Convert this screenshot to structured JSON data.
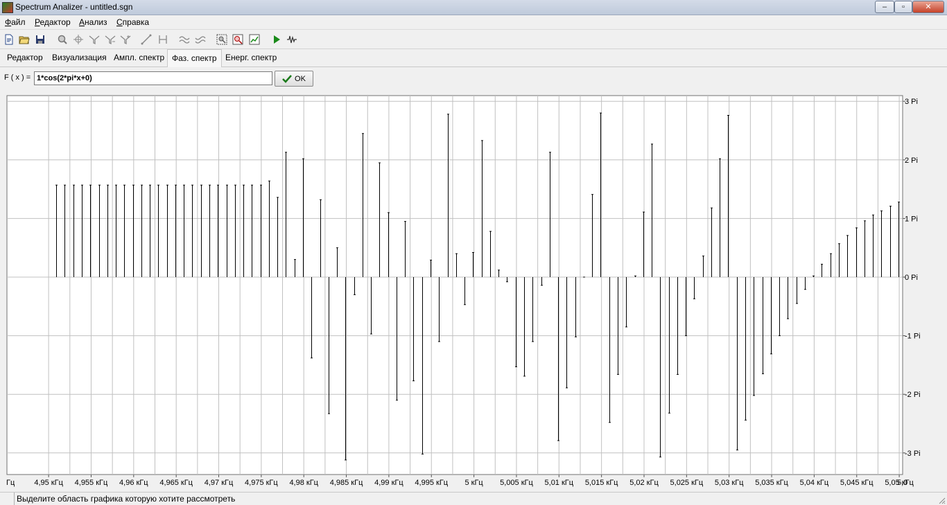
{
  "window": {
    "title": "Spectrum Analizer - untitled.sgn",
    "minimize": "–",
    "maximize": "▫",
    "close": "✕"
  },
  "menu": [
    {
      "underline": "Ф",
      "rest": "айл"
    },
    {
      "underline": "Р",
      "rest": "едактор"
    },
    {
      "underline": "А",
      "rest": "нализ"
    },
    {
      "underline": "С",
      "rest": "правка"
    }
  ],
  "toolbar": {
    "icons": [
      "new-file-icon",
      "open-folder-icon",
      "save-icon",
      "zoom-icon",
      "crosshair-icon",
      "filter-icon",
      "filter-2-icon",
      "filter-3-icon",
      "line-icon",
      "bracket-icon",
      "wave-filter-icon",
      "wave-filter-2-icon",
      "select-zoom-icon",
      "zoom-reset-icon",
      "chart-icon",
      "play-icon",
      "signal-icon"
    ]
  },
  "tabs": [
    "Редактор",
    "Визуализация",
    "Ампл. спектр",
    "Фаз. спектр",
    "Енерг. спектр"
  ],
  "active_tab": 3,
  "formula": {
    "label": "F ( x ) =",
    "value": "1*cos(2*pi*x+0)",
    "ok": "OK"
  },
  "status": {
    "text": "Выделите область графика которую хотите рассмотреть"
  },
  "colors": {
    "plot_bg": "#ffffff",
    "grid": "#c0c0c0",
    "stem": "#000000",
    "ok_check": "#1a7a1a",
    "play": "#1a8a1a"
  },
  "chart_data": {
    "type": "bar",
    "title": "",
    "xlabel": "",
    "ylabel": "",
    "y_unit": "Pi",
    "ylim": [
      -3,
      3
    ],
    "y_ticks": [
      "3 Pi",
      "2 Pi",
      "1 Pi",
      "0 Pi",
      "-1 Pi",
      "-2 Pi",
      "-3 Pi"
    ],
    "y_tick_values": [
      3,
      2,
      1,
      0,
      -1,
      -2,
      -3
    ],
    "x_unit": "kHz",
    "xlim": [
      4.9451,
      5.0504
    ],
    "x_ticks": [
      "Гц",
      "4,95 кГц",
      "4,955 кГц",
      "4,96 кГц",
      "4,965 кГц",
      "4,97 кГц",
      "4,975 кГц",
      "4,98 кГц",
      "4,985 кГц",
      "4,99 кГц",
      "4,995 кГц",
      "5 кГц",
      "5,005 кГц",
      "5,01 кГц",
      "5,015 кГц",
      "5,02 кГц",
      "5,025 кГц",
      "5,03 кГц",
      "5,035 кГц",
      "5,04 кГц",
      "5,045 кГц",
      "5,05 кГц",
      "5,0"
    ],
    "x_tick_values": [
      4.9451,
      4.95,
      4.955,
      4.96,
      4.965,
      4.97,
      4.975,
      4.98,
      4.985,
      4.99,
      4.995,
      5.0,
      5.005,
      5.01,
      5.015,
      5.02,
      5.025,
      5.03,
      5.035,
      5.04,
      5.045,
      5.05,
      5.0504
    ],
    "grid": true,
    "x": [
      4.9509,
      4.9519,
      4.9529,
      4.9539,
      4.9549,
      4.9559,
      4.9569,
      4.9579,
      4.9589,
      4.9599,
      4.9609,
      4.9619,
      4.9629,
      4.9639,
      4.9649,
      4.9659,
      4.9669,
      4.9679,
      4.9689,
      4.9699,
      4.9709,
      4.9719,
      4.9729,
      4.9739,
      4.9749,
      4.9759,
      4.9769,
      4.9779,
      4.9789,
      4.9799,
      4.9809,
      4.9819,
      4.9829,
      4.9839,
      4.9849,
      4.9859,
      4.9869,
      4.9879,
      4.9889,
      4.9899,
      4.9909,
      4.9919,
      4.9929,
      4.9939,
      4.9949,
      4.9959,
      4.9969,
      4.9979,
      4.9989,
      4.9999,
      5.0009,
      5.0019,
      5.0029,
      5.0039,
      5.0049,
      5.0059,
      5.0069,
      5.0079,
      5.0089,
      5.0099,
      5.0109,
      5.0119,
      5.0129,
      5.0139,
      5.0149,
      5.0159,
      5.0169,
      5.0179,
      5.0189,
      5.0199,
      5.0209,
      5.0219,
      5.0229,
      5.0239,
      5.0249,
      5.0259,
      5.0269,
      5.0279,
      5.0289,
      5.0299,
      5.0309,
      5.0319,
      5.0329,
      5.0339,
      5.0349,
      5.0359,
      5.0369,
      5.0379,
      5.0389,
      5.0399,
      5.0409,
      5.0419,
      5.0429,
      5.0439,
      5.0449,
      5.0459,
      5.0469,
      5.0479,
      5.0489,
      5.0499
    ],
    "values": [
      1.57,
      1.57,
      1.57,
      1.57,
      1.57,
      1.57,
      1.57,
      1.57,
      1.57,
      1.57,
      1.57,
      1.57,
      1.57,
      1.57,
      1.57,
      1.57,
      1.57,
      1.57,
      1.57,
      1.57,
      1.57,
      1.57,
      1.57,
      1.57,
      1.57,
      1.64,
      1.36,
      2.13,
      0.3,
      2.02,
      -1.38,
      1.32,
      -2.33,
      0.5,
      -3.12,
      -0.3,
      2.45,
      -0.97,
      1.95,
      1.1,
      -2.1,
      0.95,
      -1.77,
      -3.02,
      0.29,
      -1.1,
      2.78,
      0.4,
      -0.47,
      0.42,
      2.33,
      0.78,
      0.12,
      -0.08,
      -1.53,
      -1.69,
      -1.1,
      -0.14,
      2.13,
      -2.79,
      -1.89,
      -1.02,
      0.0,
      1.41,
      2.8,
      -2.48,
      -1.66,
      -0.85,
      0.02,
      1.11,
      2.27,
      -3.07,
      -2.32,
      -1.66,
      -1.0,
      -0.37,
      0.36,
      1.18,
      2.02,
      2.76,
      -2.95,
      -2.44,
      -2.02,
      -1.65,
      -1.31,
      -1.0,
      -0.71,
      -0.45,
      -0.21,
      0.02,
      0.22,
      0.4,
      0.57,
      0.71,
      0.84,
      0.96,
      1.06,
      1.13,
      1.21,
      1.28
    ]
  }
}
